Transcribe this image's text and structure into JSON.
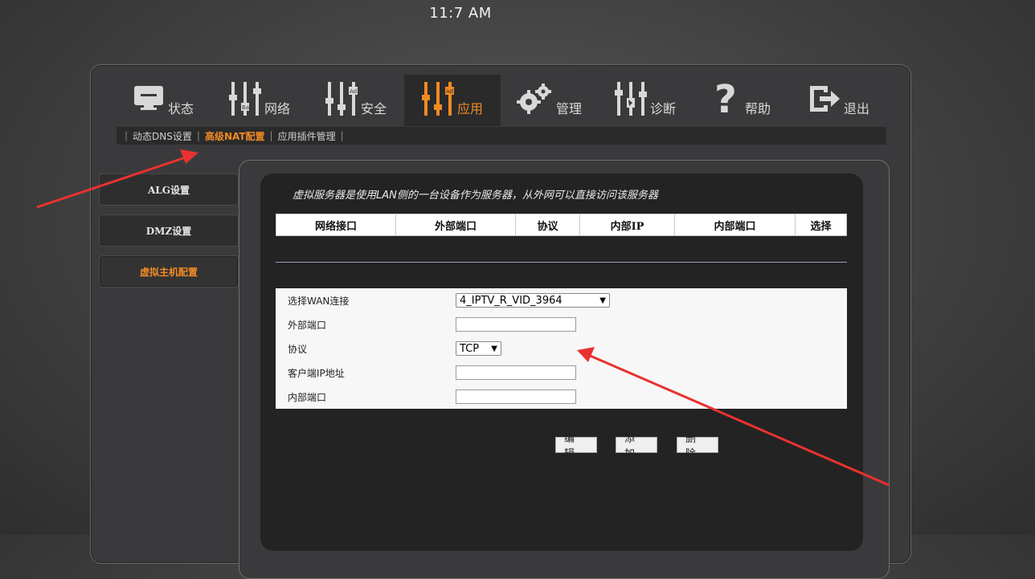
{
  "clock": "11:7 AM",
  "nav": [
    {
      "label": "状态",
      "icon": "monitor-icon"
    },
    {
      "label": "网络",
      "icon": "sliders-icon"
    },
    {
      "label": "安全",
      "icon": "sliders-icon"
    },
    {
      "label": "应用",
      "icon": "sliders-icon",
      "active": true
    },
    {
      "label": "管理",
      "icon": "gear-icon"
    },
    {
      "label": "诊断",
      "icon": "sliders-icon"
    },
    {
      "label": "帮助",
      "icon": "question-icon"
    },
    {
      "label": "退出",
      "icon": "exit-icon"
    }
  ],
  "subnav": [
    {
      "label": "动态DNS设置"
    },
    {
      "label": "高级NAT配置",
      "active": true
    },
    {
      "label": "应用插件管理"
    }
  ],
  "side": [
    {
      "label": "ALG设置"
    },
    {
      "label": "DMZ设置"
    },
    {
      "label": "虚拟主机配置",
      "active": true
    }
  ],
  "panel": {
    "description": "虚拟服务器是使用LAN侧的一台设备作为服务器，从外网可以直接访问该服务器",
    "columns": [
      "网络接口",
      "外部端口",
      "协议",
      "内部IP",
      "内部端口",
      "选择"
    ]
  },
  "form": {
    "wan_label": "选择WAN连接",
    "wan_value": "4_IPTV_R_VID_3964",
    "ext_port_label": "外部端口",
    "protocol_label": "协议",
    "protocol_value": "TCP",
    "client_ip_label": "客户端IP地址",
    "int_port_label": "内部端口"
  },
  "buttons": {
    "edit": "编辑",
    "add": "添加",
    "delete": "删除"
  },
  "colors": {
    "accent": "#f08a24",
    "annotation": "#e8322f"
  }
}
